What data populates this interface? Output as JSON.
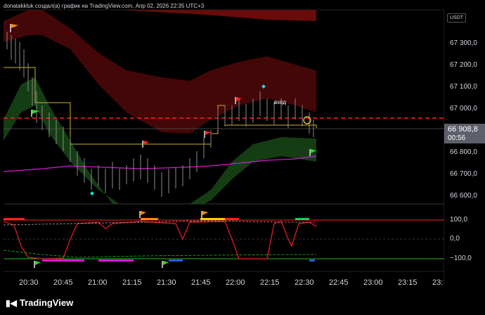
{
  "header": {
    "title": "donatakkluk создал(а) график на TradingView.com, Апр 02, 2026 22:35 UTC+3"
  },
  "price_axis": {
    "currency": "USDT",
    "labels": [
      "67 300,0",
      "67 200,0",
      "67 100,0",
      "67 000,0",
      "66 800,0",
      "66 700,0",
      "66 600,0"
    ],
    "current_price": "66 908,8",
    "countdown": "00:56"
  },
  "oscillator_axis": {
    "labels": [
      "100,0",
      "0,0",
      "−100,0"
    ]
  },
  "time_axis": {
    "labels": [
      "20:30",
      "20:45",
      "21:00",
      "21:15",
      "21:30",
      "21:45",
      "22:00",
      "22:15",
      "22:30",
      "22:45",
      "23:00",
      "23:15",
      "23:"
    ]
  },
  "annotations": {
    "entry": "вход"
  },
  "footer": {
    "brand": "TradingView"
  },
  "colors": {
    "background": "#000000",
    "red_band": "#8b0000",
    "green_band": "#1f5f1f",
    "magenta_line": "#d01cd0",
    "yellow_line": "#c8b432",
    "dashed_red": "#ff2020"
  }
}
